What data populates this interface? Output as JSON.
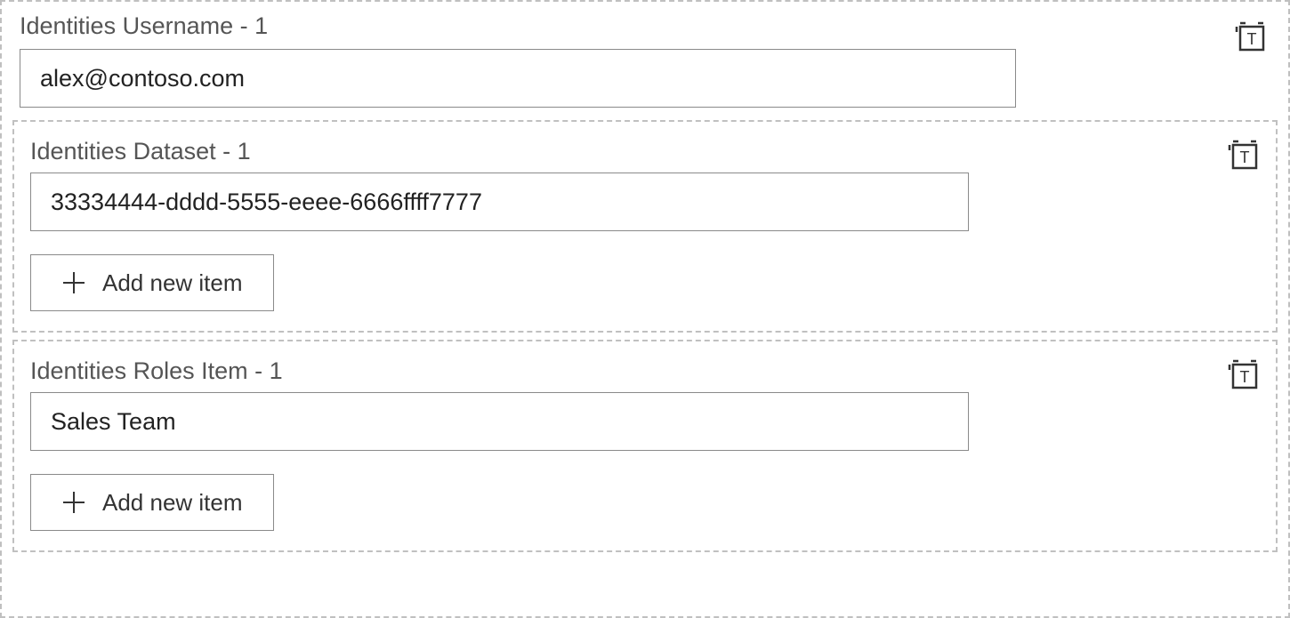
{
  "username": {
    "label": "Identities Username - 1",
    "value": "alex@contoso.com"
  },
  "dataset": {
    "label": "Identities Dataset - 1",
    "value": "33334444-dddd-5555-eeee-6666ffff7777",
    "add_label": "Add new item"
  },
  "roles": {
    "label": "Identities Roles Item - 1",
    "value": "Sales Team",
    "add_label": "Add new item"
  }
}
